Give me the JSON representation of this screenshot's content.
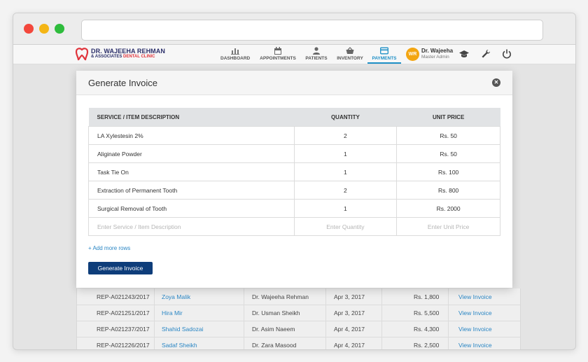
{
  "brand": {
    "name": "DR. WAJEEHA REHMAN",
    "sub_prefix": "& ASSOCIATES",
    "sub_accent": "DENTAL CLINIC"
  },
  "nav": {
    "items": [
      {
        "label": "DASHBOARD",
        "icon": "bar-chart-icon"
      },
      {
        "label": "APPOINTMENTS",
        "icon": "calendar-icon"
      },
      {
        "label": "PATIENTS",
        "icon": "person-icon"
      },
      {
        "label": "INVENTORY",
        "icon": "basket-icon"
      },
      {
        "label": "PAYMENTS",
        "icon": "card-icon"
      }
    ],
    "active": "PAYMENTS"
  },
  "user": {
    "initials": "WR",
    "name": "Dr. Wajeeha",
    "role": "Master Admin"
  },
  "colors": {
    "accent": "#1e8fc6",
    "primary_button": "#0e3d7a",
    "brand_navy": "#2b2f6a",
    "brand_red": "#e0343c",
    "avatar": "#f3a612"
  },
  "modal": {
    "title": "Generate Invoice",
    "columns": {
      "description": "SERVICE / ITEM DESCRIPTION",
      "quantity": "QUANTITY",
      "unit_price": "UNIT PRICE"
    },
    "rows": [
      {
        "description": "LA Xylestesin 2%",
        "quantity": "2",
        "unit_price": "Rs. 50"
      },
      {
        "description": "Aliginate Powder",
        "quantity": "1",
        "unit_price": "Rs. 50"
      },
      {
        "description": "Task Tie On",
        "quantity": "1",
        "unit_price": "Rs. 100"
      },
      {
        "description": "Extraction of Permanent Tooth",
        "quantity": "2",
        "unit_price": "Rs. 800"
      },
      {
        "description": "Surgical Removal of Tooth",
        "quantity": "1",
        "unit_price": "Rs. 2000"
      }
    ],
    "placeholders": {
      "description": "Enter Service / Item Description",
      "quantity": "Enter Quantity",
      "unit_price": "Enter Unit Price"
    },
    "add_more_label": "+ Add more rows",
    "generate_label": "Generate Invoice"
  },
  "background_table": {
    "rows": [
      {
        "receipt": "REP-A021243/2017",
        "patient": "Zoya Malik",
        "doctor": "Dr. Wajeeha Rehman",
        "date": "Apr 3, 2017",
        "amount": "Rs. 1,800",
        "action": "View Invoice"
      },
      {
        "receipt": "REP-A021251/2017",
        "patient": "Hira Mir",
        "doctor": "Dr. Usman Sheikh",
        "date": "Apr 3, 2017",
        "amount": "Rs. 5,500",
        "action": "View Invoice"
      },
      {
        "receipt": "REP-A021237/2017",
        "patient": "Shahid Sadozai",
        "doctor": "Dr. Asim Naeem",
        "date": "Apr 4, 2017",
        "amount": "Rs. 4,300",
        "action": "View Invoice"
      },
      {
        "receipt": "REP-A021226/2017",
        "patient": "Sadaf Sheikh",
        "doctor": "Dr. Zara Masood",
        "date": "Apr 4, 2017",
        "amount": "Rs. 2,500",
        "action": "View Invoice"
      }
    ]
  }
}
